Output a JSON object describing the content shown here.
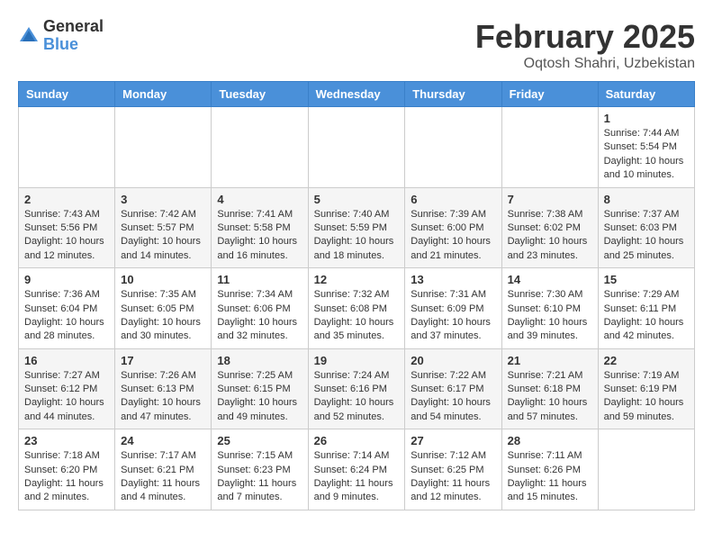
{
  "header": {
    "logo_general": "General",
    "logo_blue": "Blue",
    "month_title": "February 2025",
    "location": "Oqtosh Shahri, Uzbekistan"
  },
  "days_of_week": [
    "Sunday",
    "Monday",
    "Tuesday",
    "Wednesday",
    "Thursday",
    "Friday",
    "Saturday"
  ],
  "weeks": [
    [
      null,
      null,
      null,
      null,
      null,
      null,
      {
        "day": "1",
        "sunrise": "7:44 AM",
        "sunset": "5:54 PM",
        "daylight": "10 hours and 10 minutes."
      }
    ],
    [
      {
        "day": "2",
        "sunrise": "7:43 AM",
        "sunset": "5:56 PM",
        "daylight": "10 hours and 12 minutes."
      },
      {
        "day": "3",
        "sunrise": "7:42 AM",
        "sunset": "5:57 PM",
        "daylight": "10 hours and 14 minutes."
      },
      {
        "day": "4",
        "sunrise": "7:41 AM",
        "sunset": "5:58 PM",
        "daylight": "10 hours and 16 minutes."
      },
      {
        "day": "5",
        "sunrise": "7:40 AM",
        "sunset": "5:59 PM",
        "daylight": "10 hours and 18 minutes."
      },
      {
        "day": "6",
        "sunrise": "7:39 AM",
        "sunset": "6:00 PM",
        "daylight": "10 hours and 21 minutes."
      },
      {
        "day": "7",
        "sunrise": "7:38 AM",
        "sunset": "6:02 PM",
        "daylight": "10 hours and 23 minutes."
      },
      {
        "day": "8",
        "sunrise": "7:37 AM",
        "sunset": "6:03 PM",
        "daylight": "10 hours and 25 minutes."
      }
    ],
    [
      {
        "day": "9",
        "sunrise": "7:36 AM",
        "sunset": "6:04 PM",
        "daylight": "10 hours and 28 minutes."
      },
      {
        "day": "10",
        "sunrise": "7:35 AM",
        "sunset": "6:05 PM",
        "daylight": "10 hours and 30 minutes."
      },
      {
        "day": "11",
        "sunrise": "7:34 AM",
        "sunset": "6:06 PM",
        "daylight": "10 hours and 32 minutes."
      },
      {
        "day": "12",
        "sunrise": "7:32 AM",
        "sunset": "6:08 PM",
        "daylight": "10 hours and 35 minutes."
      },
      {
        "day": "13",
        "sunrise": "7:31 AM",
        "sunset": "6:09 PM",
        "daylight": "10 hours and 37 minutes."
      },
      {
        "day": "14",
        "sunrise": "7:30 AM",
        "sunset": "6:10 PM",
        "daylight": "10 hours and 39 minutes."
      },
      {
        "day": "15",
        "sunrise": "7:29 AM",
        "sunset": "6:11 PM",
        "daylight": "10 hours and 42 minutes."
      }
    ],
    [
      {
        "day": "16",
        "sunrise": "7:27 AM",
        "sunset": "6:12 PM",
        "daylight": "10 hours and 44 minutes."
      },
      {
        "day": "17",
        "sunrise": "7:26 AM",
        "sunset": "6:13 PM",
        "daylight": "10 hours and 47 minutes."
      },
      {
        "day": "18",
        "sunrise": "7:25 AM",
        "sunset": "6:15 PM",
        "daylight": "10 hours and 49 minutes."
      },
      {
        "day": "19",
        "sunrise": "7:24 AM",
        "sunset": "6:16 PM",
        "daylight": "10 hours and 52 minutes."
      },
      {
        "day": "20",
        "sunrise": "7:22 AM",
        "sunset": "6:17 PM",
        "daylight": "10 hours and 54 minutes."
      },
      {
        "day": "21",
        "sunrise": "7:21 AM",
        "sunset": "6:18 PM",
        "daylight": "10 hours and 57 minutes."
      },
      {
        "day": "22",
        "sunrise": "7:19 AM",
        "sunset": "6:19 PM",
        "daylight": "10 hours and 59 minutes."
      }
    ],
    [
      {
        "day": "23",
        "sunrise": "7:18 AM",
        "sunset": "6:20 PM",
        "daylight": "11 hours and 2 minutes."
      },
      {
        "day": "24",
        "sunrise": "7:17 AM",
        "sunset": "6:21 PM",
        "daylight": "11 hours and 4 minutes."
      },
      {
        "day": "25",
        "sunrise": "7:15 AM",
        "sunset": "6:23 PM",
        "daylight": "11 hours and 7 minutes."
      },
      {
        "day": "26",
        "sunrise": "7:14 AM",
        "sunset": "6:24 PM",
        "daylight": "11 hours and 9 minutes."
      },
      {
        "day": "27",
        "sunrise": "7:12 AM",
        "sunset": "6:25 PM",
        "daylight": "11 hours and 12 minutes."
      },
      {
        "day": "28",
        "sunrise": "7:11 AM",
        "sunset": "6:26 PM",
        "daylight": "11 hours and 15 minutes."
      },
      null
    ]
  ]
}
